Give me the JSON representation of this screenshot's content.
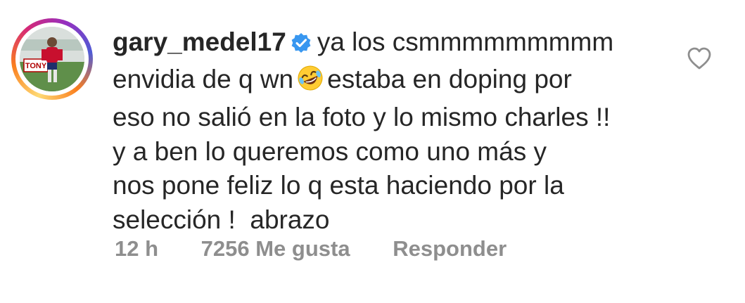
{
  "comment": {
    "username": "gary_medel17",
    "verified_icon": "verified-badge-icon",
    "text_line1": "ya los csmmmmmmmmm",
    "text_line2_a": "envidia de q wn",
    "emoji": "rofl-emoji",
    "text_line2_b": "estaba en doping por",
    "text_line3": "eso no salió en la foto y lo mismo charles !!",
    "text_line4": "y a ben lo queremos como uno más y",
    "text_line5": "nos pone feliz lo q esta haciendo por la",
    "text_line6": "selección !  abrazo",
    "avatar_text": "TONY",
    "time": "12 h",
    "likes": "7256 Me gusta",
    "reply_label": "Responder",
    "like_icon": "heart-icon"
  },
  "colors": {
    "text": "#262626",
    "meta": "#8e8e8e",
    "verified": "#3897f0"
  }
}
